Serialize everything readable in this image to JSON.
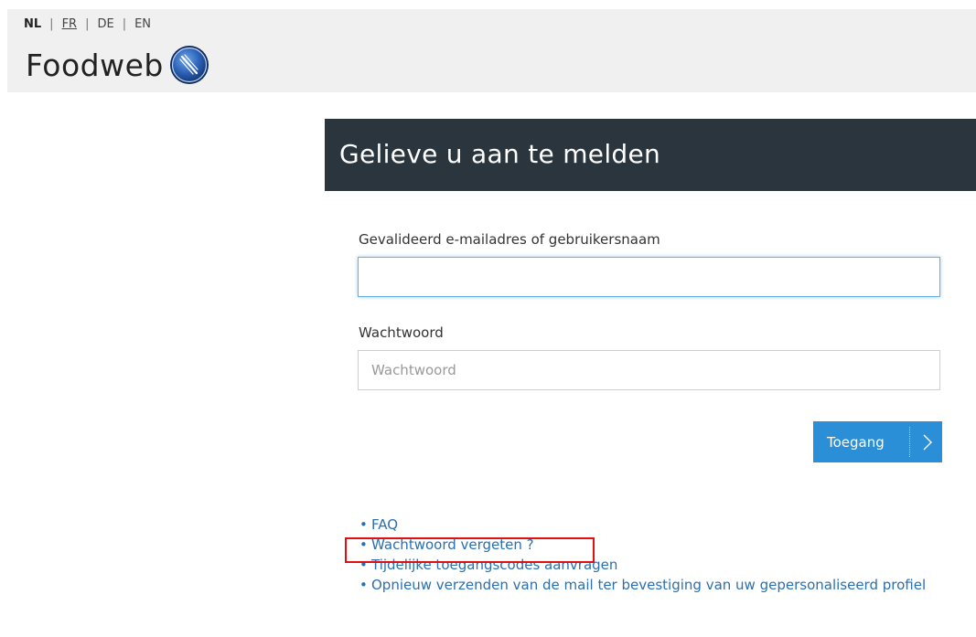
{
  "languages": [
    {
      "code": "NL",
      "active": true,
      "link": false
    },
    {
      "code": "FR",
      "active": false,
      "link": true
    },
    {
      "code": "DE",
      "active": false,
      "link": false
    },
    {
      "code": "EN",
      "active": false,
      "link": false
    }
  ],
  "brand": {
    "name": "Foodweb",
    "logo_icon": "fork-knife-icon"
  },
  "login": {
    "title": "Gelieve u aan te melden",
    "username_label": "Gevalideerd e-mailadres of gebruikersnaam",
    "username_value": "",
    "username_placeholder": "",
    "password_label": "Wachtwoord",
    "password_value": "",
    "password_placeholder": "Wachtwoord",
    "submit_label": "Toegang",
    "submit_icon": "chevron-right-icon"
  },
  "links": [
    {
      "label": "FAQ"
    },
    {
      "label": "Wachtwoord vergeten ?"
    },
    {
      "label": "Tijdelijke toegangscodes aanvragen"
    },
    {
      "label": "Opnieuw verzenden van de mail ter bevestiging van uw gepersonaliseerd profiel"
    }
  ],
  "colors": {
    "header_bg": "#f0f0f0",
    "panel_header_bg": "#2b353d",
    "button_bg": "#2b8fd8",
    "link_color": "#2a6fb0",
    "highlight": "#e01010"
  }
}
